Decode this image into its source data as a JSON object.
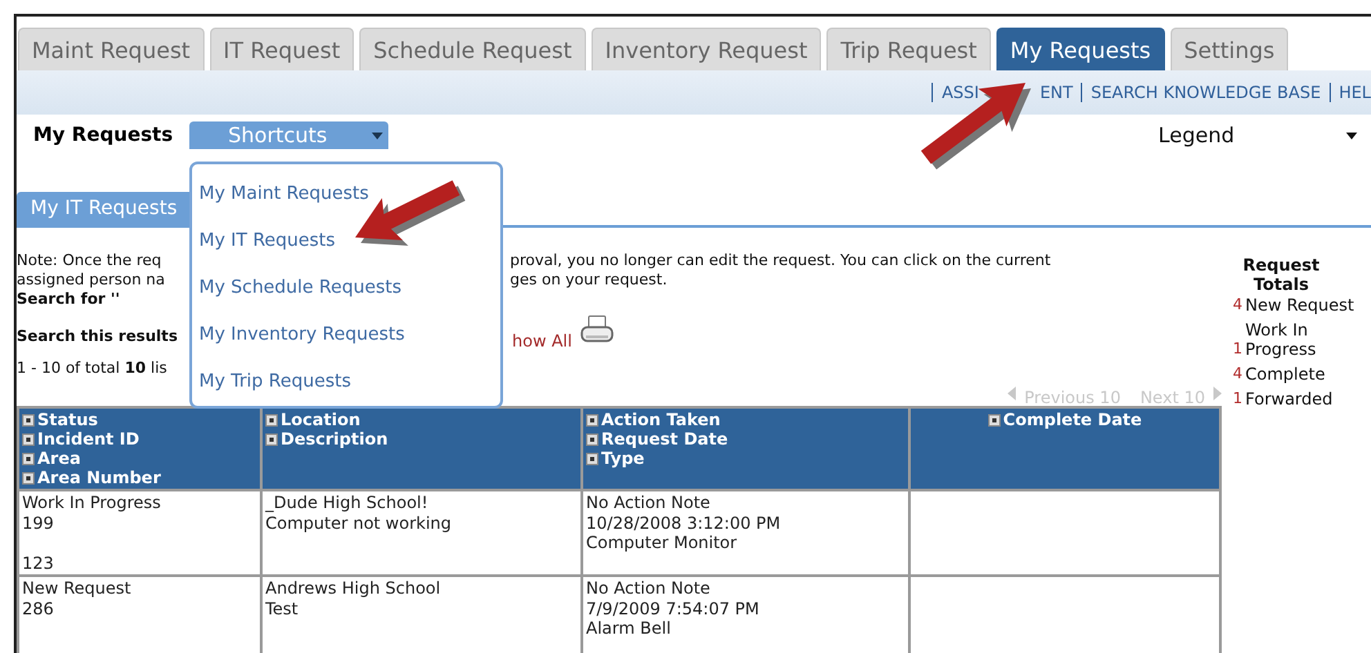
{
  "tabs": [
    {
      "label": "Maint Request",
      "selected": false
    },
    {
      "label": "IT Request",
      "selected": false
    },
    {
      "label": "Schedule Request",
      "selected": false
    },
    {
      "label": "Inventory Request",
      "selected": false
    },
    {
      "label": "Trip Request",
      "selected": false
    },
    {
      "label": "My Requests",
      "selected": true
    },
    {
      "label": "Settings",
      "selected": false
    }
  ],
  "nav_links": [
    {
      "parts": [
        "ASSI",
        "ENT"
      ]
    },
    {
      "parts": [
        "SEARCH KNOWLEDGE BASE"
      ]
    },
    {
      "parts": [
        "HEL"
      ]
    }
  ],
  "toolbar": {
    "title": "My Requests",
    "shortcuts_button": "Shortcuts",
    "legend": "Legend"
  },
  "shortcuts_menu": {
    "items": [
      "My Maint Requests",
      "My IT Requests",
      "My Schedule Requests",
      "My Inventory Requests",
      "My Trip Requests"
    ]
  },
  "section_tab": "My IT Requests",
  "note": {
    "lines": [
      [
        "Note: Once the req",
        "proval, you no longer can edit the request. You can click on the current"
      ],
      [
        "assigned person na",
        "ges on your request."
      ]
    ]
  },
  "search_for": "Search for ''",
  "search_results_label": "Search this results",
  "show_all_link": "how All",
  "result_count": "1 - 10 of total **10** lis",
  "pagination": {
    "previous": "Previous 10",
    "next": "Next 10"
  },
  "request_totals": {
    "title": "Request Totals",
    "items": [
      {
        "count": "4",
        "label": "New Request"
      },
      {
        "count": "1",
        "label": "Work In Progress"
      },
      {
        "count": "4",
        "label": "Complete"
      },
      {
        "count": "1",
        "label": "Forwarded"
      }
    ]
  },
  "table": {
    "columns": [
      {
        "labels": [
          "Status",
          "Incident ID",
          "Area",
          "Area Number"
        ]
      },
      {
        "labels": [
          "Location",
          "Description"
        ]
      },
      {
        "labels": [
          "Action Taken",
          "Request Date",
          "Type"
        ]
      },
      {
        "labels": [
          "Complete Date"
        ]
      }
    ],
    "rows": [
      {
        "cells": [
          {
            "lines": [
              "Work In Progress",
              "199"
            ],
            "area_number": "123"
          },
          {
            "lines": [
              "_Dude High School!",
              "Computer not working"
            ]
          },
          {
            "lines": [
              "No Action Note",
              "10/28/2008 3:12:00 PM",
              "Computer Monitor"
            ]
          },
          {}
        ]
      },
      {
        "cells": [
          {
            "lines": [
              "New Request",
              "286"
            ]
          },
          {
            "lines": [
              "Andrews High School",
              "Test"
            ]
          },
          {
            "lines": [
              "No Action Note",
              "7/9/2009 7:54:07 PM",
              "Alarm Bell"
            ]
          },
          {}
        ]
      }
    ]
  }
}
